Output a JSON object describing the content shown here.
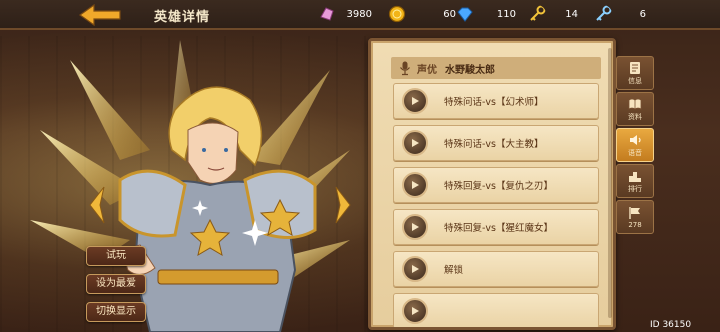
{
  "header": {
    "title": "英雄详情",
    "back_icon": "back-arrow-icon"
  },
  "resources": [
    {
      "icon": "crystal-icon",
      "value": "3980",
      "color": "#e79ad9"
    },
    {
      "icon": "gold-coin-icon",
      "value": "60",
      "color": "#f2b418"
    },
    {
      "icon": "diamond-icon",
      "value": "110",
      "color": "#4aa8ff"
    },
    {
      "icon": "gold-key-icon",
      "value": "14",
      "color": "#f2c33a"
    },
    {
      "icon": "silver-key-icon",
      "value": "6",
      "color": "#8ad0ff"
    }
  ],
  "hero_actions": {
    "trial": "试玩",
    "favorite": "设为最爱",
    "toggle_display": "切换显示"
  },
  "voice_panel": {
    "cv_label": "声优",
    "cv_name": "水野駿太郎",
    "lines": [
      "特殊问话-vs【幻术师】",
      "特殊问话-vs【大主教】",
      "特殊回复-vs【复仇之刃】",
      "特殊回复-vs【猩红魔女】",
      "解锁"
    ]
  },
  "side_tabs": [
    {
      "label": "信息",
      "icon": "info-scroll-icon",
      "active": false
    },
    {
      "label": "资料",
      "icon": "book-icon",
      "active": false
    },
    {
      "label": "语音",
      "icon": "speaker-icon",
      "active": true
    },
    {
      "label": "排行",
      "icon": "ranking-icon",
      "active": false
    },
    {
      "label": "278",
      "icon": "flag-icon",
      "active": false
    }
  ],
  "footer": {
    "user_id": "ID 36150"
  },
  "colors": {
    "accent": "#e9a940",
    "panel_bg": "#f0dcb3",
    "frame": "#7a5432"
  }
}
